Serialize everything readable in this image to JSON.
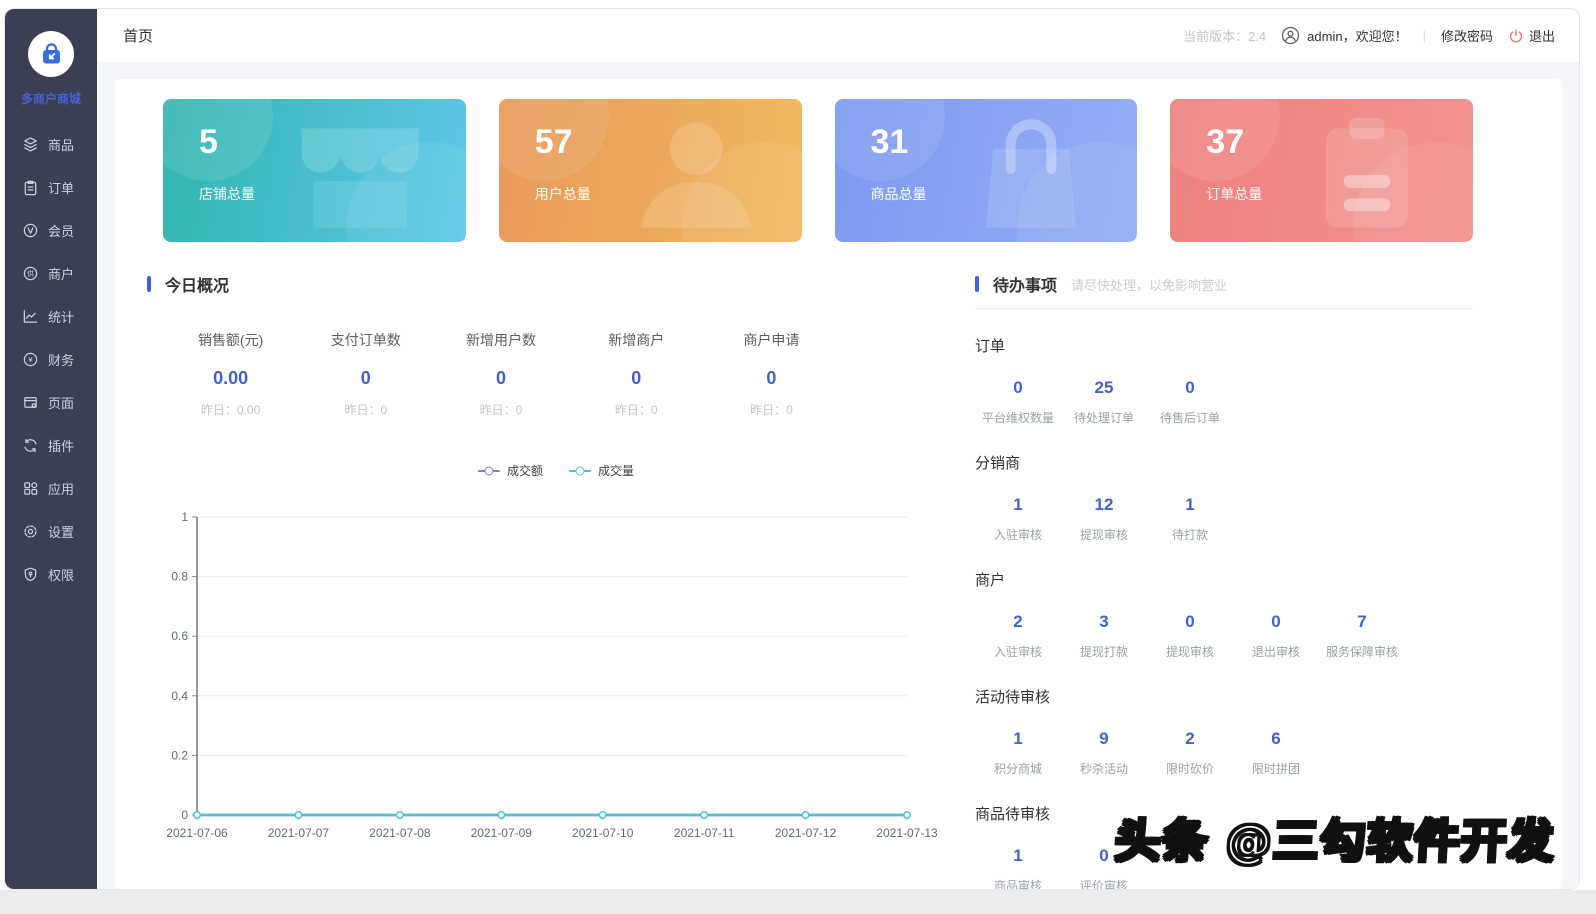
{
  "brand": {
    "name": "多商户商城"
  },
  "sidebar": {
    "items": [
      {
        "label": "商品",
        "icon": "layers-icon"
      },
      {
        "label": "订单",
        "icon": "clipboard-icon"
      },
      {
        "label": "会员",
        "icon": "member-v-icon"
      },
      {
        "label": "商户",
        "icon": "merchant-circle-icon"
      },
      {
        "label": "统计",
        "icon": "line-chart-icon"
      },
      {
        "label": "财务",
        "icon": "finance-yen-icon"
      },
      {
        "label": "页面",
        "icon": "page-window-icon"
      },
      {
        "label": "插件",
        "icon": "plugin-refresh-icon"
      },
      {
        "label": "应用",
        "icon": "apps-grid-icon"
      },
      {
        "label": "设置",
        "icon": "gear-icon"
      },
      {
        "label": "权限",
        "icon": "shield-icon"
      }
    ]
  },
  "header": {
    "breadcrumb": "首页",
    "version": "当前版本：2.4",
    "username": "admin，欢迎您！",
    "change_password": "修改密码",
    "logout": "退出"
  },
  "stat_cards": [
    {
      "value": "5",
      "label": "店铺总量",
      "icon": "storefront-icon",
      "gradient": [
        "#33b6b0",
        "#5ec7e8"
      ]
    },
    {
      "value": "57",
      "label": "用户总量",
      "icon": "person-icon",
      "gradient": [
        "#e8985a",
        "#f1ba61"
      ]
    },
    {
      "value": "31",
      "label": "商品总量",
      "icon": "shopping-bag-icon",
      "gradient": [
        "#7d9aef",
        "#93aef6"
      ]
    },
    {
      "value": "37",
      "label": "订单总量",
      "icon": "clipboard-icon",
      "gradient": [
        "#ee817e",
        "#f29390"
      ]
    }
  ],
  "today": {
    "title": "今日概况",
    "stats": [
      {
        "label": "销售额(元)",
        "value": "0.00",
        "yesterday": "昨日：0.00"
      },
      {
        "label": "支付订单数",
        "value": "0",
        "yesterday": "昨日：0"
      },
      {
        "label": "新增用户数",
        "value": "0",
        "yesterday": "昨日：0"
      },
      {
        "label": "新增商户",
        "value": "0",
        "yesterday": "昨日：0"
      },
      {
        "label": "商户申请",
        "value": "0",
        "yesterday": "昨日：0"
      }
    ]
  },
  "chart_data": {
    "type": "line",
    "x": [
      "2021-07-06",
      "2021-07-07",
      "2021-07-08",
      "2021-07-09",
      "2021-07-10",
      "2021-07-11",
      "2021-07-12",
      "2021-07-13"
    ],
    "series": [
      {
        "name": "成交额",
        "color": "#7583d2",
        "values": [
          0,
          0,
          0,
          0,
          0,
          0,
          0,
          0
        ]
      },
      {
        "name": "成交量",
        "color": "#45c6d6",
        "values": [
          0,
          0,
          0,
          0,
          0,
          0,
          0,
          0
        ]
      }
    ],
    "ylim": [
      0,
      1
    ],
    "yticks": [
      0,
      0.2,
      0.4,
      0.6,
      0.8,
      1
    ],
    "grid": true,
    "legend_position": "top-center",
    "title": "",
    "xlabel": "",
    "ylabel": ""
  },
  "todo": {
    "title": "待办事项",
    "subtitle": "请尽快处理，以免影响营业",
    "groups": [
      {
        "name": "订单",
        "items": [
          {
            "value": "0",
            "label": "平台维权数量"
          },
          {
            "value": "25",
            "label": "待处理订单"
          },
          {
            "value": "0",
            "label": "待售后订单"
          }
        ]
      },
      {
        "name": "分销商",
        "items": [
          {
            "value": "1",
            "label": "入驻审核"
          },
          {
            "value": "12",
            "label": "提现审核"
          },
          {
            "value": "1",
            "label": "待打款"
          }
        ]
      },
      {
        "name": "商户",
        "items": [
          {
            "value": "2",
            "label": "入驻审核"
          },
          {
            "value": "3",
            "label": "提现打款"
          },
          {
            "value": "0",
            "label": "提现审核"
          },
          {
            "value": "0",
            "label": "退出审核"
          },
          {
            "value": "7",
            "label": "服务保障审核"
          }
        ]
      },
      {
        "name": "活动待审核",
        "items": [
          {
            "value": "1",
            "label": "积分商城"
          },
          {
            "value": "9",
            "label": "秒杀活动"
          },
          {
            "value": "2",
            "label": "限时砍价"
          },
          {
            "value": "6",
            "label": "限时拼团"
          }
        ]
      },
      {
        "name": "商品待审核",
        "items": [
          {
            "value": "1",
            "label": "商品审核"
          },
          {
            "value": "0",
            "label": "评价审核"
          }
        ]
      }
    ]
  },
  "watermark": {
    "text": "头条 @三勾软件开发"
  },
  "colors": {
    "accent_blue": "#4161d2",
    "section_bar_blue": "#3e62d9",
    "sidebar_bg": "#3a3f54",
    "brand_blue": "#4263d8",
    "logout_red": "#f56c6c",
    "muted_gray": "#c0c4cc",
    "line_amount": "#7583d2",
    "line_volume": "#45c6d6"
  }
}
